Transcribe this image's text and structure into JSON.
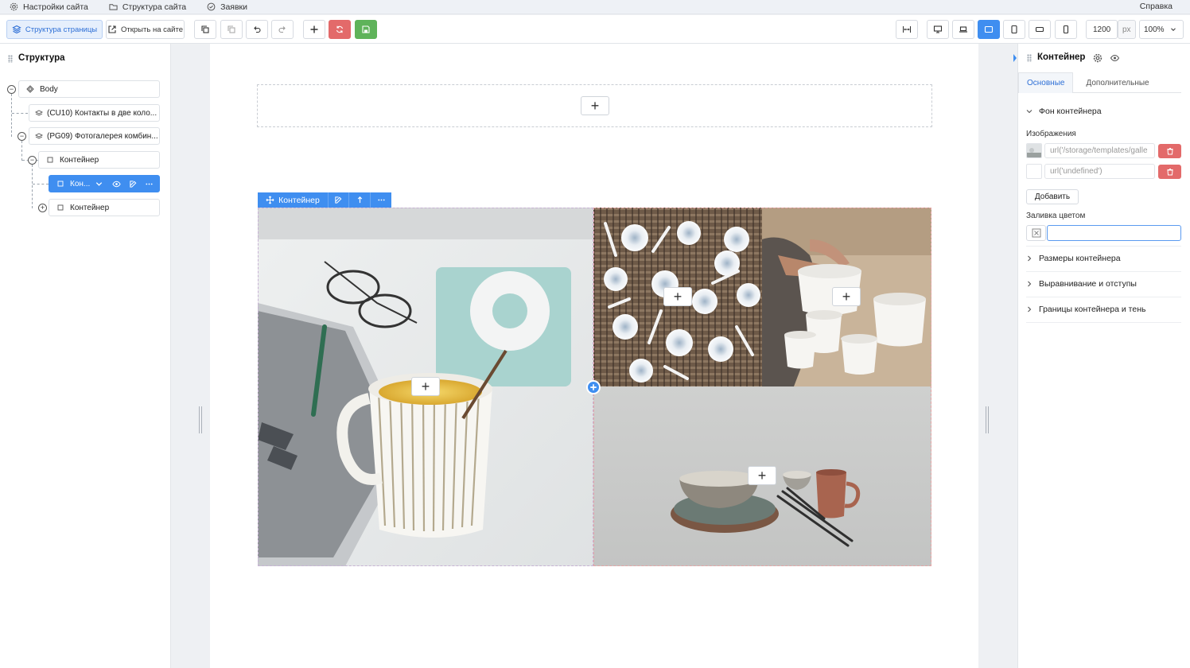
{
  "menubar": {
    "items": [
      {
        "label": "Настройки сайта",
        "icon": "gear-icon"
      },
      {
        "label": "Структура сайта",
        "icon": "folder-icon"
      },
      {
        "label": "Заявки",
        "icon": "check-circle-icon"
      }
    ],
    "help": "Справка"
  },
  "toolbar": {
    "page_structure": "Структура страницы",
    "open_on_site": "Открыть на сайте",
    "width_value": "1200",
    "width_unit": "px",
    "zoom": "100%"
  },
  "left_panel": {
    "title": "Структура",
    "nodes": [
      {
        "label": "Body"
      },
      {
        "label": "(CU10) Контакты в две коло..."
      },
      {
        "label": "(PG09) Фотогалерея комбин..."
      },
      {
        "label": "Контейнер"
      },
      {
        "label": "Кон..."
      },
      {
        "label": "Контейнер"
      }
    ]
  },
  "canvas": {
    "context_label": "Контейнер"
  },
  "right_panel": {
    "title": "Контейнер",
    "tabs": [
      "Основные",
      "Дополнительные"
    ],
    "bg_section": "Фон контейнера",
    "images_label": "Изображения",
    "image_1": "url('/storage/templates/galle",
    "image_2": "url('undefined')",
    "add_button": "Добавить",
    "color_fill_label": "Заливка цветом",
    "sections": [
      "Размеры контейнера",
      "Выравнивание и отступы",
      "Границы контейнера и тень"
    ]
  },
  "colors": {
    "accent": "#3f8ef0",
    "danger": "#e36a6a",
    "success": "#5fb35a"
  }
}
